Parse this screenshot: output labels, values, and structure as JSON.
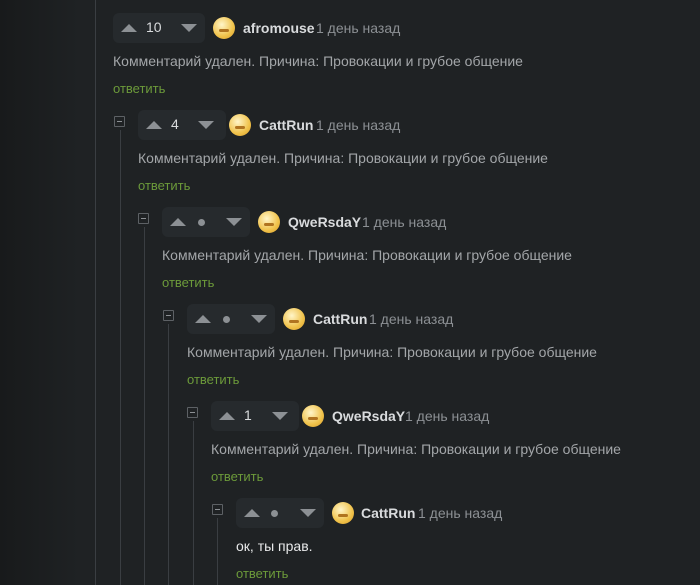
{
  "comments": [
    {
      "author": "afromouse",
      "time": "1 день назад",
      "rating": "10",
      "body": "Комментарий удален. Причина: Провокации и грубое общение",
      "reply": "ответить"
    },
    {
      "author": "CattRun",
      "time": "1 день назад",
      "rating": "4",
      "body": "Комментарий удален. Причина: Провокации и грубое общение",
      "reply": "ответить"
    },
    {
      "author": "QweRsdaY",
      "time": "1 день назад",
      "rating": null,
      "body": "Комментарий удален. Причина: Провокации и грубое общение",
      "reply": "ответить"
    },
    {
      "author": "CattRun",
      "time": "1 день назад",
      "rating": null,
      "body": "Комментарий удален. Причина: Провокации и грубое общение",
      "reply": "ответить"
    },
    {
      "author": "QweRsdaY",
      "time": "1 день назад",
      "rating": "1",
      "body": "Комментарий удален. Причина: Провокации и грубое общение",
      "reply": "ответить"
    },
    {
      "author": "CattRun",
      "time": "1 день назад",
      "rating": null,
      "body": "ок, ты прав.",
      "reply": "ответить"
    }
  ],
  "colors": {
    "background": "#1f2224",
    "reply_link": "#6c9a3a",
    "deleted_text": "#a3a6a9"
  }
}
